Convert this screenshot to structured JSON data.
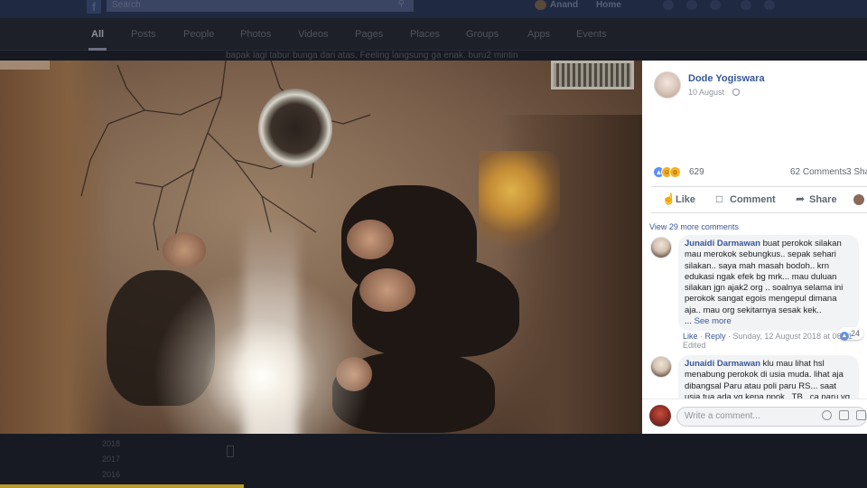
{
  "topbar": {
    "search_placeholder": "Search",
    "user_name": "Anand",
    "home_label": "Home"
  },
  "search_tabs": [
    "All",
    "Posts",
    "People",
    "Photos",
    "Videos",
    "Pages",
    "Places",
    "Groups",
    "Apps",
    "Events"
  ],
  "background": {
    "caption": "bapak lagi tabur bunga dari atas. Feeling langsung ga enak. buru2 mintin",
    "years": [
      "2018",
      "2017",
      "2016"
    ]
  },
  "post": {
    "author": "Dode Yogiswara",
    "date": "10 August",
    "reaction_count": "629",
    "comments_count": "62 Comments",
    "shares_count": "3 Sha",
    "actions": {
      "like": "Like",
      "comment": "Comment",
      "share": "Share"
    },
    "view_more_comments": "View 29 more comments",
    "comments": [
      {
        "author": "Junaidi Darmawan",
        "lines": [
          "buat perokok silakan",
          "mau merokok sebungkus.. sepak sehari",
          "silakan.. saya mah masah bodoh.. krn",
          "edukasi ngak efek bg mrk... mau duluan",
          "silakan jgn ajak2 org .. soalnya selama ini",
          "perokok sangat egois mengepul dimana",
          "aja.. mau org sekitarnya sesak kek.."
        ],
        "see_more": "See more",
        "reactions": "24",
        "meta": {
          "like": "Like",
          "reply": "Reply",
          "timestamp": "Sunday, 12 August 2018 at 06:31"
        },
        "edited": "Edited"
      },
      {
        "author": "Junaidi Darmawan",
        "lines": [
          "klu mau lihat hsl",
          "menabung perokok di usia muda. lihat aja",
          "dibangsal Paru atau poli paru RS... saat",
          "usia tua ada yg kena ppok.. TB.. ca paru yg"
        ]
      }
    ],
    "compose_placeholder": "Write a comment..."
  },
  "icons": {
    "search": "search-icon",
    "globe": "globe-icon",
    "like": "thumbs-up-icon",
    "comment": "speech-bubble-icon",
    "share": "share-arrow-icon",
    "emoji": "emoji-icon",
    "camera": "camera-icon",
    "sticker": "sticker-icon"
  },
  "colors": {
    "link": "#385898",
    "topbar": "#1f2942",
    "like_reaction": "#5890ff"
  }
}
